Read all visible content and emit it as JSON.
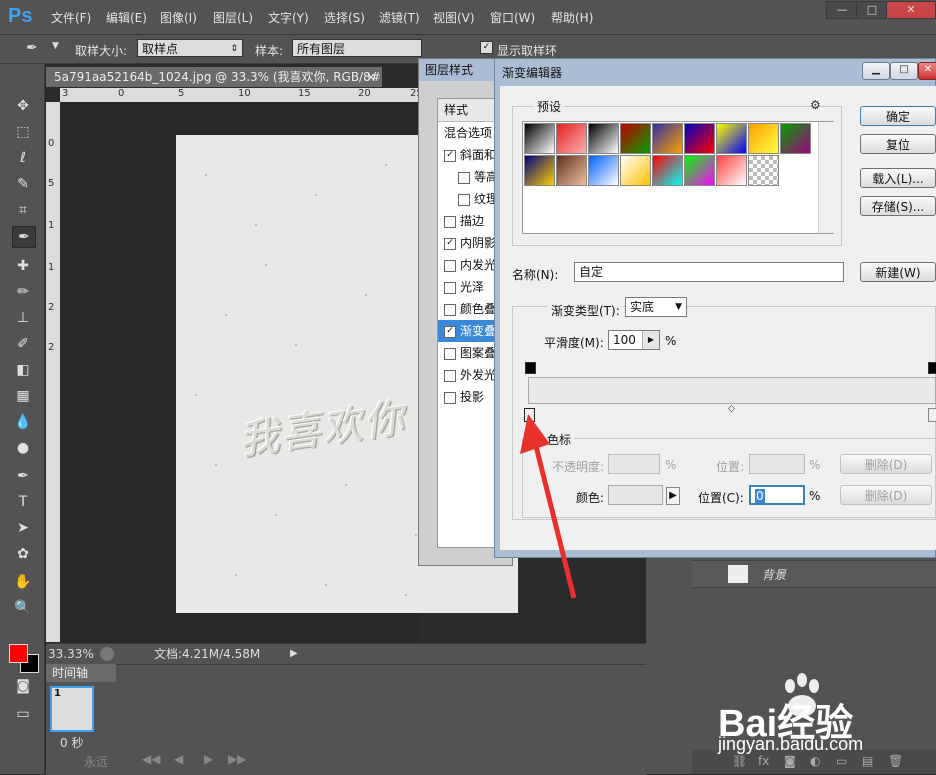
{
  "app": {
    "logo": "Ps",
    "menu": [
      "文件(F)",
      "编辑(E)",
      "图像(I)",
      "图层(L)",
      "文字(Y)",
      "选择(S)",
      "滤镜(T)",
      "视图(V)",
      "窗口(W)",
      "帮助(H)"
    ],
    "window_buttons": {
      "minimize": "—",
      "restore": "□",
      "close": "✕"
    }
  },
  "options_bar": {
    "sample_size_label": "取样大小:",
    "sample_size_value": "取样点",
    "sample_label": "样本:",
    "sample_value": "所有图层",
    "show_ring_label": "显示取样环"
  },
  "document": {
    "tab_title": "5a791aa52164b_1024.jpg @ 33.3% (我喜欢你, RGB/8#) *",
    "close": "×",
    "ruler_top": [
      "3",
      "0",
      "5",
      "10",
      "15",
      "20",
      "25"
    ],
    "ruler_left": [
      "0",
      "5",
      "1",
      "1",
      "2",
      "2"
    ],
    "embossed_text": "我喜欢你",
    "zoom": "33.33%",
    "doc_info": "文档:4.21M/4.58M"
  },
  "timeline": {
    "tab": "时间轴",
    "frame_number": "1",
    "frame_delay": "0 秒",
    "loop": "永远"
  },
  "layers": {
    "background_name": "背景"
  },
  "layer_style": {
    "title": "图层样式",
    "styles_header": "样式",
    "blend_options": "混合选项",
    "items": [
      {
        "label": "斜面和",
        "checked": true,
        "indent": false
      },
      {
        "label": "等高",
        "checked": false,
        "indent": true
      },
      {
        "label": "纹理",
        "checked": false,
        "indent": true
      },
      {
        "label": "描边",
        "checked": false,
        "indent": false
      },
      {
        "label": "内阴影",
        "checked": true,
        "indent": false
      },
      {
        "label": "内发光",
        "checked": false,
        "indent": false
      },
      {
        "label": "光泽",
        "checked": false,
        "indent": false
      },
      {
        "label": "颜色叠",
        "checked": false,
        "indent": false
      },
      {
        "label": "渐变叠",
        "checked": true,
        "indent": false,
        "selected": true
      },
      {
        "label": "图案叠",
        "checked": false,
        "indent": false
      },
      {
        "label": "外发光",
        "checked": false,
        "indent": false
      },
      {
        "label": "投影",
        "checked": false,
        "indent": false
      }
    ]
  },
  "gradient_editor": {
    "title": "渐变编辑器",
    "presets_label": "预设",
    "presets": [
      [
        "#000000",
        "#ffffff"
      ],
      [
        "#e02020",
        "#ffb0b0"
      ],
      [
        "#000000",
        "#ffffff"
      ],
      [
        "#c00000",
        "#00a000"
      ],
      [
        "#3030a0",
        "#ffa000"
      ],
      [
        "#0000c0",
        "#ff0000"
      ],
      [
        "#ffff00",
        "#0000ff"
      ],
      [
        "#ffa000",
        "#ffff40"
      ],
      [
        "#00a000",
        "#a00080"
      ],
      [
        "#000080",
        "#ffd000"
      ],
      [
        "#603020",
        "#f0c0a0"
      ],
      [
        "#0060ff",
        "#ffffff"
      ],
      [
        "#ffffff",
        "#ffc000"
      ],
      [
        "#ff0000",
        "#00ffff"
      ],
      [
        "#00ff00",
        "#ff00ff"
      ],
      [
        "#ff4040",
        "#ffffff"
      ],
      [
        "#b0b0b0",
        "#ffffff"
      ]
    ],
    "ok": "确定",
    "reset": "复位",
    "load": "载入(L)...",
    "save": "存储(S)...",
    "name_label": "名称(N):",
    "name_value": "自定",
    "new": "新建(W)",
    "gradient_type_label": "渐变类型(T):",
    "gradient_type_value": "实底",
    "smoothness_label": "平滑度(M):",
    "smoothness_value": "100",
    "percent": "%",
    "stops_label": "色标",
    "opacity_label": "不透明度:",
    "location_label": "位置:",
    "delete_top": "删除(D)",
    "color_label": "颜色:",
    "location_c_label": "位置(C):",
    "location_value": "0",
    "delete_bottom": "删除(D)"
  },
  "watermark": {
    "brand": "Bai经验",
    "url": "jingyan.baidu.com"
  },
  "colors": {
    "foreground": "#ff0000",
    "background": "#000000",
    "selection": "#3a88d8",
    "arrow": "#e8302c"
  }
}
